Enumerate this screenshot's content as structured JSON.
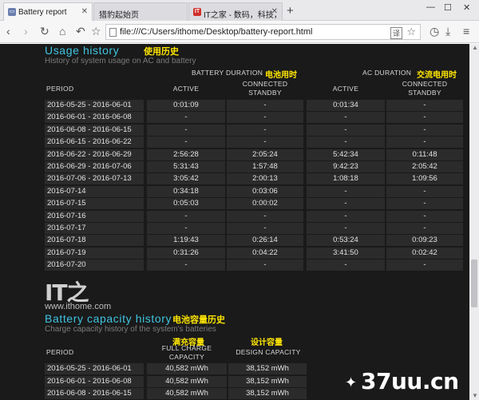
{
  "browser": {
    "tabs": [
      {
        "label": "Battery report",
        "active": true
      },
      {
        "label": "猎豹起始页",
        "active": false
      },
      {
        "label": "IT之家 - 数码，科技，生",
        "active": false
      }
    ],
    "url": "file:///C:/Users/ithome/Desktop/battery-report.html",
    "translate_glyph": "译",
    "win_min": "—",
    "win_max": "☐",
    "win_close": "✕",
    "new_tab": "+"
  },
  "usage": {
    "title": "Usage history",
    "subtitle": "History of system usage on AC and battery",
    "cn_title": "使用历史",
    "headers": {
      "battery_duration": "BATTERY DURATION",
      "battery_duration_cn": "电池用时",
      "ac_duration": "AC DURATION",
      "ac_duration_cn": "交流电用时",
      "period": "PERIOD",
      "active": "ACTIVE",
      "connected_standby_1": "CONNECTED",
      "connected_standby_2": "STANDBY"
    },
    "rows": [
      {
        "period": "2016-05-25 - 2016-06-01",
        "b_active": "0:01:09",
        "b_standby": "-",
        "ac_active": "0:01:34",
        "ac_standby": "-"
      },
      {
        "period": "2016-06-01 - 2016-06-08",
        "b_active": "-",
        "b_standby": "-",
        "ac_active": "-",
        "ac_standby": "-"
      },
      {
        "period": "2016-06-08 - 2016-06-15",
        "b_active": "-",
        "b_standby": "-",
        "ac_active": "-",
        "ac_standby": "-"
      },
      {
        "period": "2016-06-15 - 2016-06-22",
        "b_active": "-",
        "b_standby": "-",
        "ac_active": "-",
        "ac_standby": "-"
      },
      {
        "period": "2016-06-22 - 2016-06-29",
        "b_active": "2:56:28",
        "b_standby": "2:05:24",
        "ac_active": "5:42:34",
        "ac_standby": "0:11:48"
      },
      {
        "period": "2016-06-29 - 2016-07-06",
        "b_active": "5:31:43",
        "b_standby": "1:57:48",
        "ac_active": "9:42:23",
        "ac_standby": "2:05:42"
      },
      {
        "period": "2016-07-06 - 2016-07-13",
        "b_active": "3:05:42",
        "b_standby": "2:00:13",
        "ac_active": "1:08:18",
        "ac_standby": "1:09:56"
      },
      {
        "period": "2016-07-14",
        "b_active": "0:34:18",
        "b_standby": "0:03:06",
        "ac_active": "-",
        "ac_standby": "-"
      },
      {
        "period": "2016-07-15",
        "b_active": "0:05:03",
        "b_standby": "0:00:02",
        "ac_active": "-",
        "ac_standby": "-"
      },
      {
        "period": "2016-07-16",
        "b_active": "-",
        "b_standby": "-",
        "ac_active": "-",
        "ac_standby": "-"
      },
      {
        "period": "2016-07-17",
        "b_active": "-",
        "b_standby": "-",
        "ac_active": "-",
        "ac_standby": "-"
      },
      {
        "period": "2016-07-18",
        "b_active": "1:19:43",
        "b_standby": "0:26:14",
        "ac_active": "0:53:24",
        "ac_standby": "0:09:23"
      },
      {
        "period": "2016-07-19",
        "b_active": "0:31:26",
        "b_standby": "0:04:22",
        "ac_active": "3:41:50",
        "ac_standby": "0:02:42"
      },
      {
        "period": "2016-07-20",
        "b_active": "-",
        "b_standby": "-",
        "ac_active": "-",
        "ac_standby": "-"
      }
    ]
  },
  "watermark": {
    "logo": "IT之",
    "url": "www.ithome.com"
  },
  "capacity": {
    "title": "Battery capacity history",
    "cn_title": "电池容量历史",
    "subtitle": "Charge capacity history of the system's batteries",
    "headers": {
      "period": "PERIOD",
      "full_charge_cn": "满充容量",
      "full_charge_1": "FULL CHARGE",
      "full_charge_2": "CAPACITY",
      "design_cn": "设计容量",
      "design": "DESIGN CAPACITY"
    },
    "rows": [
      {
        "period": "2016-05-25 - 2016-06-01",
        "full": "40,582 mWh",
        "design": "38,152 mWh"
      },
      {
        "period": "2016-06-01 - 2016-06-08",
        "full": "40,582 mWh",
        "design": "38,152 mWh"
      },
      {
        "period": "2016-06-08 - 2016-06-15",
        "full": "40,582 mWh",
        "design": "38,152 mWh"
      }
    ]
  },
  "site_logo": {
    "text": "37uu.cn"
  },
  "colors": {
    "accent": "#3fc4e0",
    "annotation": "#ffe600",
    "background": "#1a1a1a",
    "cell": "#2b2b2b"
  }
}
